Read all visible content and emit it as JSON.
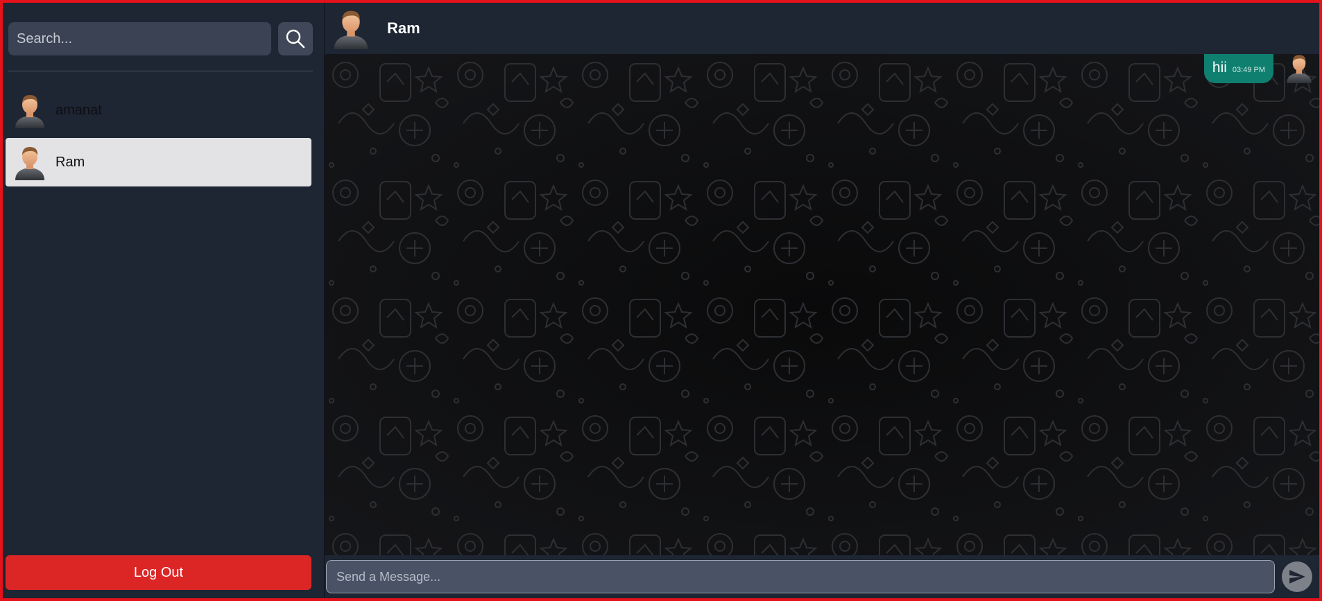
{
  "sidebar": {
    "search": {
      "placeholder": "Search...",
      "value": ""
    },
    "contacts": [
      {
        "name": "amanat",
        "active": false
      },
      {
        "name": "Ram",
        "active": true
      }
    ],
    "logout_label": "Log Out"
  },
  "chat": {
    "header": {
      "name": "Ram"
    },
    "messages": [
      {
        "text": "hii",
        "time": "03:49 PM",
        "outgoing": true
      }
    ],
    "composer": {
      "placeholder": "Send a Message...",
      "value": ""
    }
  },
  "icons": {
    "search": "search-icon",
    "send": "send-icon",
    "avatar": "user-avatar-icon"
  },
  "colors": {
    "sidebar_bg": "#1e2533",
    "logout_bg": "#dc2626",
    "bubble_bg": "#0f7f70",
    "active_contact_bg": "#e3e3e6",
    "frame_border": "#e3121b"
  }
}
